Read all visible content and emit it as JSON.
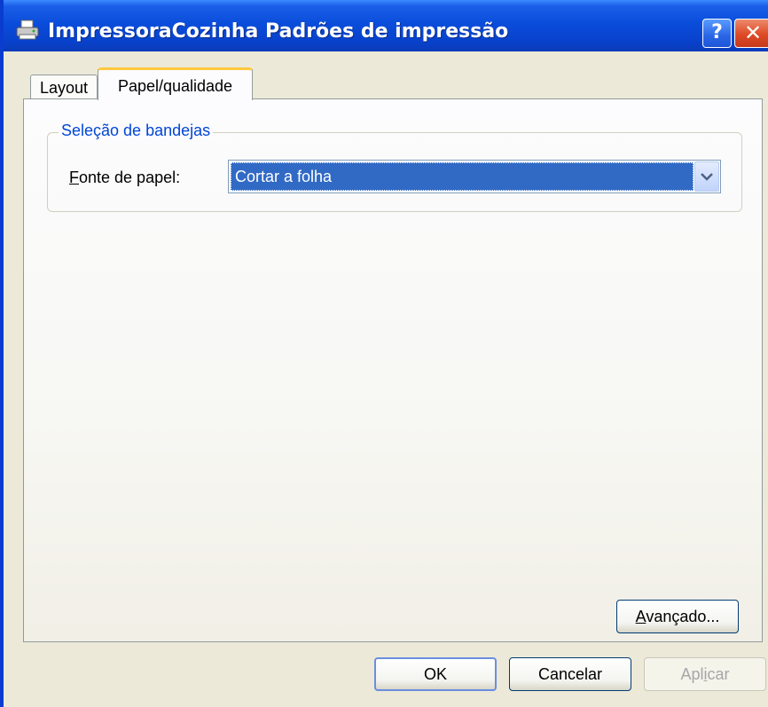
{
  "window": {
    "title": "ImpressoraCozinha Padrões de impressão",
    "icon": "printer-icon",
    "help_button": "?",
    "close_button": "✕"
  },
  "tabs": [
    {
      "label": "Layout",
      "selected": false
    },
    {
      "label": "Papel/qualidade",
      "selected": true
    }
  ],
  "tray_group": {
    "title": "Seleção de bandejas",
    "paper_source_label_mnemonic": "F",
    "paper_source_label_rest": "onte de papel:",
    "paper_source_value": "Cortar a folha"
  },
  "advanced_button": {
    "mnemonic": "A",
    "rest": "vançado..."
  },
  "dialog_buttons": {
    "ok": "OK",
    "cancel": "Cancelar",
    "apply_pre": "Apl",
    "apply_mnemonic": "i",
    "apply_post": "car",
    "apply_enabled": false
  },
  "colors": {
    "titlebar": "#0a4ddb",
    "selection": "#316ac5",
    "group_title": "#0046d5",
    "tab_highlight": "#ffc83c"
  }
}
